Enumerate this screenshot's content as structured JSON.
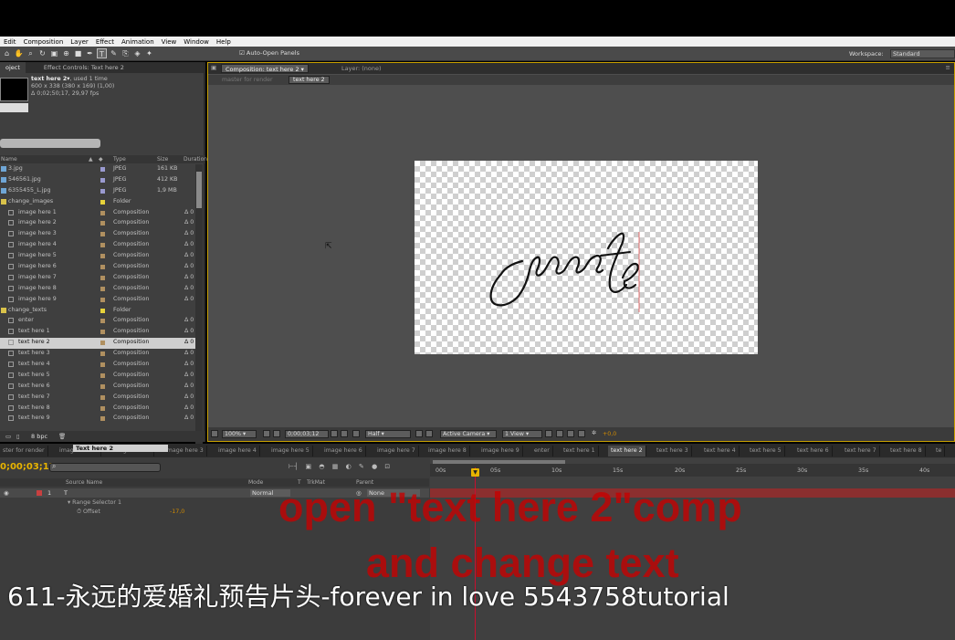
{
  "menu": [
    "Edit",
    "Composition",
    "Layer",
    "Effect",
    "Animation",
    "View",
    "Window",
    "Help"
  ],
  "toolbar": {
    "auto_open_panels": "Auto-Open Panels",
    "workspace_label": "Workspace:",
    "workspace_value": "Standard"
  },
  "project_panel": {
    "tab_project": "oject",
    "tab_effect_controls": "Effect Controls: Text here 2",
    "selected_name": "text here 2▾",
    "selected_used": ", used 1 time",
    "selected_dims": "600 x 338  (380 x 169) (1,00)",
    "selected_duration": "Δ 0;02;50;17, 29,97 fps",
    "columns": {
      "name": "Name",
      "type": "Type",
      "size": "Size",
      "duration": "Duration"
    },
    "items": [
      {
        "name": "3.jpg",
        "type": "JPEG",
        "size": "161 KB",
        "dur": "",
        "color": "#9a9ad0",
        "indent": 0
      },
      {
        "name": "546561.jpg",
        "type": "JPEG",
        "size": "412 KB",
        "dur": "",
        "color": "#9a9ad0",
        "indent": 0
      },
      {
        "name": "6355455_L.jpg",
        "type": "JPEG",
        "size": "1,9 MB",
        "dur": "",
        "color": "#9a9ad0",
        "indent": 0
      },
      {
        "name": "change_images",
        "type": "Folder",
        "size": "",
        "dur": "",
        "color": "#e6d23a",
        "indent": 0
      },
      {
        "name": "image here 1",
        "type": "Composition",
        "size": "",
        "dur": "Δ 0",
        "color": "#b09060",
        "indent": 1
      },
      {
        "name": "image here 2",
        "type": "Composition",
        "size": "",
        "dur": "Δ 0",
        "color": "#b09060",
        "indent": 1
      },
      {
        "name": "image here 3",
        "type": "Composition",
        "size": "",
        "dur": "Δ 0",
        "color": "#b09060",
        "indent": 1
      },
      {
        "name": "image here 4",
        "type": "Composition",
        "size": "",
        "dur": "Δ 0",
        "color": "#b09060",
        "indent": 1
      },
      {
        "name": "image here 5",
        "type": "Composition",
        "size": "",
        "dur": "Δ 0",
        "color": "#b09060",
        "indent": 1
      },
      {
        "name": "image here 6",
        "type": "Composition",
        "size": "",
        "dur": "Δ 0",
        "color": "#b09060",
        "indent": 1
      },
      {
        "name": "image here 7",
        "type": "Composition",
        "size": "",
        "dur": "Δ 0",
        "color": "#b09060",
        "indent": 1
      },
      {
        "name": "image here 8",
        "type": "Composition",
        "size": "",
        "dur": "Δ 0",
        "color": "#b09060",
        "indent": 1
      },
      {
        "name": "image here 9",
        "type": "Composition",
        "size": "",
        "dur": "Δ 0",
        "color": "#b09060",
        "indent": 1
      },
      {
        "name": "change_texts",
        "type": "Folder",
        "size": "",
        "dur": "",
        "color": "#e6d23a",
        "indent": 0
      },
      {
        "name": "enter",
        "type": "Composition",
        "size": "",
        "dur": "Δ 0",
        "color": "#b09060",
        "indent": 1
      },
      {
        "name": "text here 1",
        "type": "Composition",
        "size": "",
        "dur": "Δ 0",
        "color": "#b09060",
        "indent": 1
      },
      {
        "name": "text here 2",
        "type": "Composition",
        "size": "",
        "dur": "Δ 0",
        "color": "#b09060",
        "indent": 1,
        "selected": true
      },
      {
        "name": "text here 3",
        "type": "Composition",
        "size": "",
        "dur": "Δ 0",
        "color": "#b09060",
        "indent": 1
      },
      {
        "name": "text here 4",
        "type": "Composition",
        "size": "",
        "dur": "Δ 0",
        "color": "#b09060",
        "indent": 1
      },
      {
        "name": "text here 5",
        "type": "Composition",
        "size": "",
        "dur": "Δ 0",
        "color": "#b09060",
        "indent": 1
      },
      {
        "name": "text here 6",
        "type": "Composition",
        "size": "",
        "dur": "Δ 0",
        "color": "#b09060",
        "indent": 1
      },
      {
        "name": "text here 7",
        "type": "Composition",
        "size": "",
        "dur": "Δ 0",
        "color": "#b09060",
        "indent": 1
      },
      {
        "name": "text here 8",
        "type": "Composition",
        "size": "",
        "dur": "Δ 0",
        "color": "#b09060",
        "indent": 1
      },
      {
        "name": "text here 9",
        "type": "Composition",
        "size": "",
        "dur": "Δ 0",
        "color": "#b09060",
        "indent": 1
      }
    ],
    "bpc": "8 bpc"
  },
  "comp_panel": {
    "tab_comp": "Composition: text here 2",
    "tab_layer": "Layer: (none)",
    "crumb_parent": "master for render",
    "crumb_current": "text here 2",
    "canvas_text": "your te",
    "zoom": "100%",
    "timecode": "0;00;03;12",
    "resolution": "Half",
    "camera": "Active Camera",
    "view": "1 View",
    "exposure": "+0,0"
  },
  "timeline": {
    "tabs": [
      "ster for render",
      "image here 1",
      "image here 2",
      "image here 3",
      "image here 4",
      "image here 5",
      "image here 6",
      "image here 7",
      "image here 8",
      "image here 9",
      "enter",
      "text here 1",
      "text here 2",
      "text here 3",
      "text here 4",
      "text here 5",
      "text here 6",
      "text here 7",
      "text here 8",
      "te"
    ],
    "active_tab": "text here 2",
    "current_time": "0;00;03;12",
    "columns": {
      "source_name": "Source Name",
      "mode": "Mode",
      "t": "T",
      "trkmat": "TrkMat",
      "parent": "Parent"
    },
    "layer": {
      "num": "1",
      "name": "Text here 2",
      "mode": "Normal",
      "parent": "None"
    },
    "range_selector": "Range Selector 1",
    "offset_label": "Offset",
    "offset_value": "-17,0",
    "ruler_ticks": [
      "00s",
      "05s",
      "10s",
      "15s",
      "20s",
      "25s",
      "30s",
      "35s",
      "40s"
    ]
  },
  "overlay": {
    "line1": "open \"text here 2\"comp",
    "line2": "and change text",
    "caption": "611-永远的爱婚礼预告片头-forever in love 5543758tutorial"
  }
}
